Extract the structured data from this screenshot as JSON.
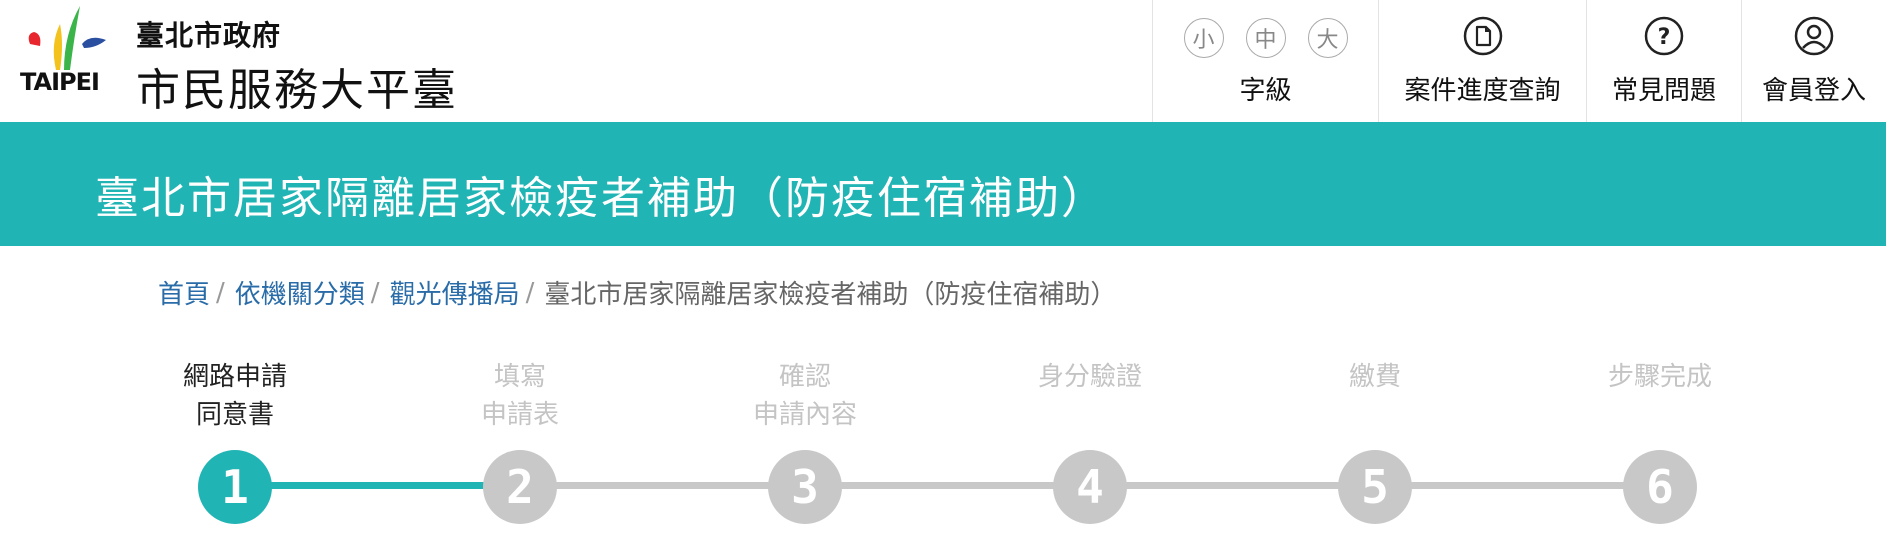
{
  "header": {
    "logo_word": "TAIPEI",
    "brand_top": "臺北市政府",
    "brand_main": "市民服務大平臺",
    "font_size_buttons": [
      "小",
      "中",
      "大"
    ],
    "font_size_label": "字級",
    "nav": [
      {
        "label": "案件進度查詢",
        "icon": "document-icon"
      },
      {
        "label": "常見問題",
        "icon": "question-icon"
      },
      {
        "label": "會員登入",
        "icon": "user-icon"
      }
    ]
  },
  "banner": {
    "title": "臺北市居家隔離居家檢疫者補助（防疫住宿補助）"
  },
  "breadcrumb": {
    "items": [
      "首頁",
      "依機關分類",
      "觀光傳播局"
    ],
    "separator": "/",
    "current": "臺北市居家隔離居家檢疫者補助（防疫住宿補助）"
  },
  "steps": {
    "active_index": 0,
    "items": [
      {
        "number": "1",
        "label": "網路申請\n同意書"
      },
      {
        "number": "2",
        "label": "填寫\n申請表"
      },
      {
        "number": "3",
        "label": "確認\n申請內容"
      },
      {
        "number": "4",
        "label": "身分驗證"
      },
      {
        "number": "5",
        "label": "繳費"
      },
      {
        "number": "6",
        "label": "步驟完成"
      }
    ]
  },
  "colors": {
    "accent": "#21b4b4",
    "inactive": "#c8c8c8",
    "link": "#2a6ca8"
  }
}
